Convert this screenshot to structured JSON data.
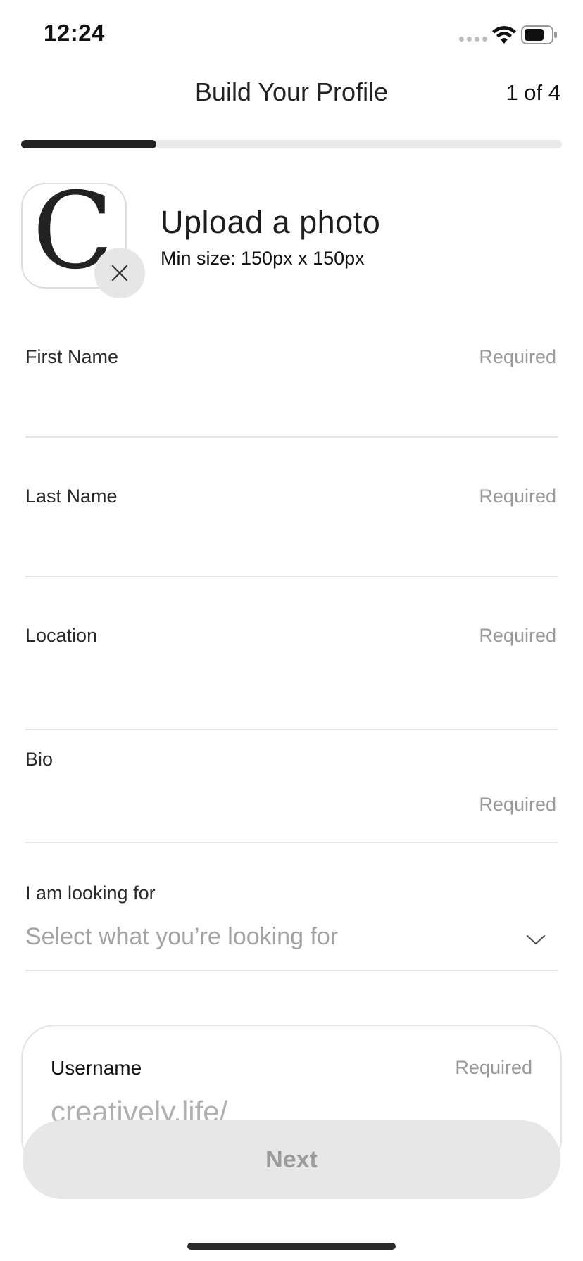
{
  "status_bar": {
    "time": "12:24",
    "icons": [
      "signal-dots-icon",
      "wifi-icon",
      "battery-icon"
    ]
  },
  "header": {
    "title": "Build Your Profile",
    "step_counter": "1 of 4",
    "progress_fraction": 0.25
  },
  "photo": {
    "avatar_letter": "C",
    "remove_icon": "close-icon",
    "title": "Upload a photo",
    "hint": "Min size: 150px x 150px"
  },
  "fields": {
    "first_name": {
      "label": "First Name",
      "required": "Required",
      "value": ""
    },
    "last_name": {
      "label": "Last Name",
      "required": "Required",
      "value": ""
    },
    "location": {
      "label": "Location",
      "required": "Required",
      "value": ""
    },
    "bio": {
      "label": "Bio",
      "required": "Required",
      "value": ""
    },
    "looking_for": {
      "label": "I am looking for",
      "placeholder": "Select what you’re looking for",
      "icon": "chevron-down-icon"
    }
  },
  "username": {
    "label": "Username",
    "required": "Required",
    "prefix": "creatively.life/"
  },
  "next_button": {
    "label": "Next"
  },
  "colors": {
    "text": "#1c1c1c",
    "muted": "#9a9a9a",
    "progress_fill": "#222222",
    "progress_track": "#e9e9e9",
    "button_bg": "#e7e7e7",
    "divider": "#e4e4e4"
  }
}
